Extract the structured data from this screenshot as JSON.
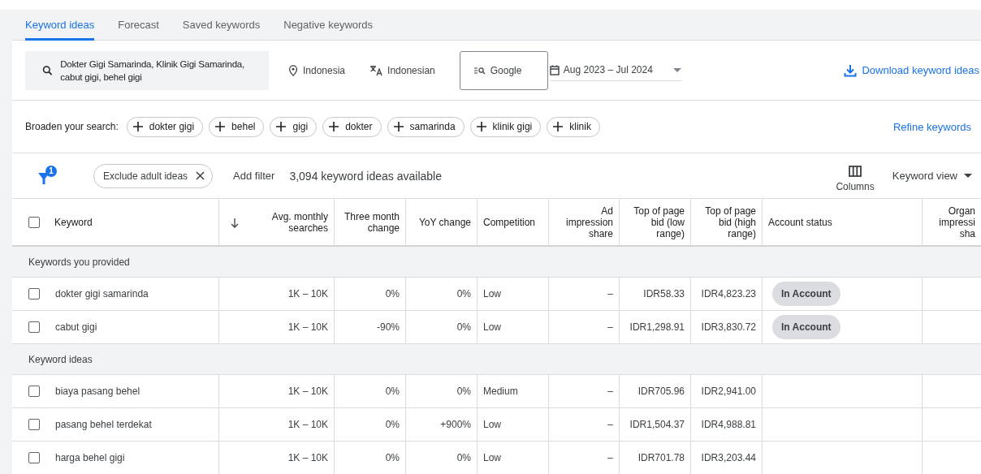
{
  "tabs": [
    {
      "label": "Keyword ideas",
      "selected": true
    },
    {
      "label": "Forecast",
      "selected": false
    },
    {
      "label": "Saved keywords",
      "selected": false
    },
    {
      "label": "Negative keywords",
      "selected": false
    }
  ],
  "search": {
    "value": "Dokter Gigi Samarinda, Klinik Gigi Samarinda, cabut gigi, behel gigi",
    "location": "Indonesia",
    "language": "Indonesian",
    "network": "Google",
    "date_range": "Aug 2023 – Jul 2024",
    "download": "Download keyword ideas"
  },
  "broaden": {
    "label": "Broaden your search:",
    "chips": [
      "dokter gigi",
      "behel",
      "gigi",
      "dokter",
      "samarinda",
      "klinik gigi",
      "klinik"
    ],
    "refine": "Refine keywords"
  },
  "filter_bar": {
    "badge": "1",
    "chip": "Exclude adult ideas",
    "add_filter": "Add filter",
    "count": "3,094 keyword ideas available",
    "columns": "Columns",
    "view": "Keyword view"
  },
  "table": {
    "all_checked": false,
    "columns": [
      {
        "label": "Keyword",
        "sorted": false
      },
      {
        "label": "Avg. monthly\nsearches",
        "sorted": true
      },
      {
        "label": "Three month\nchange",
        "sorted": false
      },
      {
        "label": "YoY change",
        "sorted": false
      },
      {
        "label": "Competition",
        "sorted": false
      },
      {
        "label": "Ad impression\nshare",
        "sorted": false
      },
      {
        "label": "Top of page\nbid (low\nrange)",
        "sorted": false
      },
      {
        "label": "Top of page\nbid (high\nrange)",
        "sorted": false
      },
      {
        "label": "Account status",
        "sorted": false
      },
      {
        "label": "Organ\nimpressi\nsha",
        "sorted": false
      }
    ],
    "groups": [
      {
        "title": "Keywords you provided",
        "rows": [
          {
            "keyword": "dokter gigi samarinda",
            "checked": false,
            "cells": [
              "1K – 10K",
              "0%",
              "0%",
              "Low",
              "–",
              "IDR58.33",
              "IDR4,823.23"
            ],
            "account_status": "In Account"
          },
          {
            "keyword": "cabut gigi",
            "checked": false,
            "cells": [
              "1K – 10K",
              "-90%",
              "0%",
              "Low",
              "–",
              "IDR1,298.91",
              "IDR3,830.72"
            ],
            "account_status": "In Account"
          }
        ]
      },
      {
        "title": "Keyword ideas",
        "rows": [
          {
            "keyword": "biaya pasang behel",
            "checked": false,
            "cells": [
              "1K – 10K",
              "0%",
              "0%",
              "Medium",
              "–",
              "IDR705.96",
              "IDR2,941.00"
            ]
          },
          {
            "keyword": "pasang behel terdekat",
            "checked": false,
            "cells": [
              "1K – 10K",
              "0%",
              "+900%",
              "Low",
              "–",
              "IDR1,504.37",
              "IDR4,988.81"
            ]
          },
          {
            "keyword": "harga behel gigi",
            "checked": false,
            "cells": [
              "1K – 10K",
              "0%",
              "0%",
              "Low",
              "–",
              "IDR701.78",
              "IDR3,203.44"
            ]
          }
        ]
      }
    ]
  }
}
